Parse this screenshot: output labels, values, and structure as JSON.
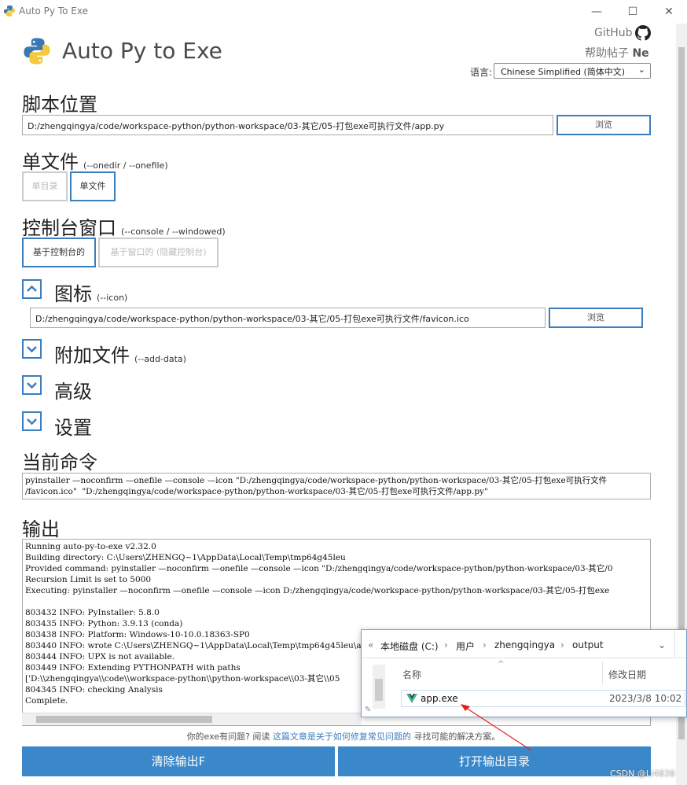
{
  "window": {
    "title": "Auto Py To Exe",
    "minimize_label": "—",
    "maximize_label": "☐",
    "close_label": "✕"
  },
  "header": {
    "brand": "Auto Py to Exe",
    "github": "GitHub",
    "help": "帮助帖子",
    "help_suffix": "Ne",
    "language_label": "语言:",
    "language_value": "Chinese Simplified (简体中文)"
  },
  "script": {
    "title": "脚本位置",
    "path": "D:/zhengqingya/code/workspace-python/python-workspace/03-其它/05-打包exe可执行文件/app.py",
    "browse": "浏览"
  },
  "onefile": {
    "title": "单文件",
    "subtitle": "(--onedir / --onefile)",
    "option_dir": "单目录",
    "option_file": "单文件"
  },
  "console": {
    "title": "控制台窗口",
    "subtitle": "(--console / --windowed)",
    "option_console": "基于控制台的",
    "option_windowed": "基于窗口的 (隐藏控制台)"
  },
  "icon": {
    "title": "图标",
    "subtitle": "(--icon)",
    "path": "D:/zhengqingya/code/workspace-python/python-workspace/03-其它/05-打包exe可执行文件/favicon.ico",
    "browse": "浏览"
  },
  "additional": {
    "title": "附加文件",
    "subtitle": "(--add-data)"
  },
  "advanced": {
    "title": "高级"
  },
  "settings": {
    "title": "设置"
  },
  "command": {
    "title": "当前命令",
    "lines": [
      "pyinstaller —noconfirm —onefile —console —icon \"D:/zhengqingya/code/workspace-python/python-workspace/03-其它/05-打包exe可执行文件",
      "/favicon.ico\"  \"D:/zhengqingya/code/workspace-python/python-workspace/03-其它/05-打包exe可执行文件/app.py\""
    ]
  },
  "output": {
    "title": "输出",
    "lines": [
      "Running auto-py-to-exe v2.32.0",
      "Building directory: C:\\Users\\ZHENGQ~1\\AppData\\Local\\Temp\\tmp64g45leu",
      "Provided command: pyinstaller —noconfirm —onefile —console —icon \"D:/zhengqingya/code/workspace-python/python-workspace/03-其它/0",
      "Recursion Limit is set to 5000",
      "Executing: pyinstaller —noconfirm —onefile —console —icon D:/zhengqingya/code/workspace-python/python-workspace/03-其它/05-打包exe",
      "",
      "803432 INFO: PyInstaller: 5.8.0",
      "803435 INFO: Python: 3.9.13 (conda)",
      "803438 INFO: Platform: Windows-10-10.0.18363-SP0",
      "803440 INFO: wrote C:\\Users\\ZHENGQ~1\\AppData\\Local\\Temp\\tmp64g45leu\\app.",
      "803444 INFO: UPX is not available.",
      "803449 INFO: Extending PYTHONPATH with paths",
      "['D:\\\\zhengqingya\\\\code\\\\workspace-python\\\\python-workspace\\\\03-其它\\\\05",
      "804345 INFO: checking Analysis",
      "Complete."
    ]
  },
  "hint": {
    "prefix": "你的exe有问题? 阅读",
    "link": "这篇文章是关于如何修复常见问题的",
    "suffix": "寻找可能的解决方案。"
  },
  "buttons": {
    "clear": "清除输出F",
    "open_output": "打开输出目录"
  },
  "explorer": {
    "crumbs": [
      "«",
      "本地磁盘 (C:)",
      "›",
      "用户",
      "›",
      "zhengqingya",
      "›",
      "output"
    ],
    "col_name": "名称",
    "col_date": "修改日期",
    "file_name": "app.exe",
    "file_date": "2023/3/8 10:02"
  },
  "watermark": "CSDN @Li4836",
  "colors": {
    "accent": "#3a87c9",
    "border_accent": "#3b7ebf",
    "arrow": "#e02020"
  }
}
